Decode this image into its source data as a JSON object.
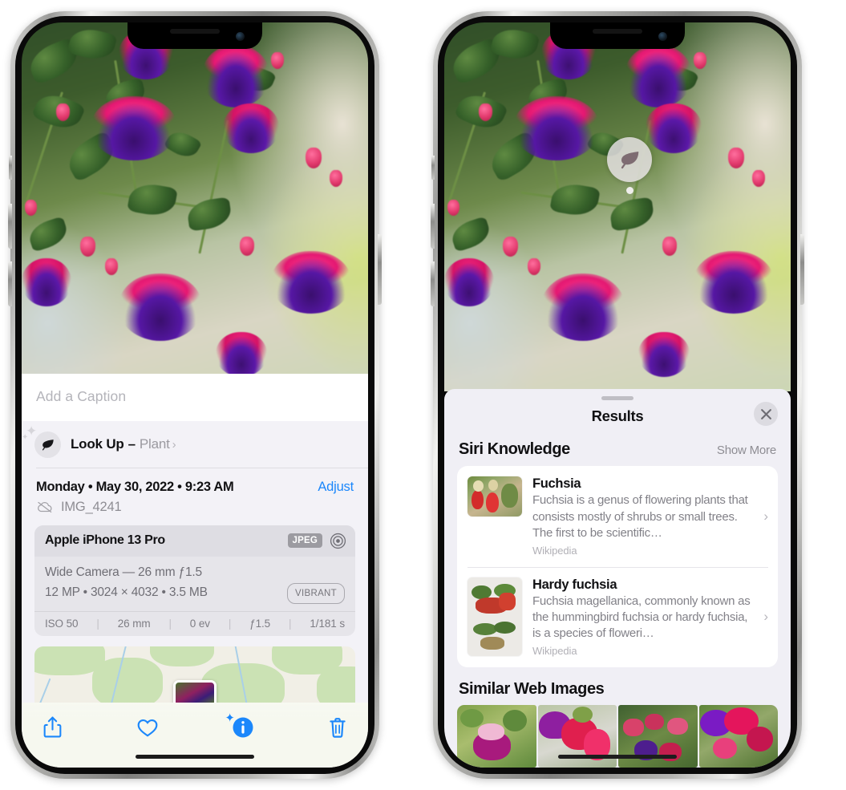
{
  "left_phone": {
    "name": "photos-detail-view",
    "caption_field": {
      "placeholder": "Add a Caption",
      "value": ""
    },
    "look_up": {
      "icon": "leaf-icon",
      "sparkle_icon": "sparkles-icon",
      "label": "Look Up",
      "separator": "–",
      "value": "Plant",
      "chevron": "›"
    },
    "datetime": {
      "text": "Monday • May 30, 2022 • 9:23 AM",
      "adjust_label": "Adjust"
    },
    "filename": {
      "icon": "cloud-slash-icon",
      "text": "IMG_4241"
    },
    "metadata": {
      "device": "Apple iPhone 13 Pro",
      "format_badge": "JPEG",
      "target_icon": "aperture-target-icon",
      "lens_line": "Wide Camera — 26 mm ƒ1.5",
      "specs_line": "12 MP • 3024 × 4032 • 3.5 MB",
      "style_badge": "VIBRANT",
      "exif": [
        {
          "label": "ISO 50"
        },
        {
          "label": "26 mm"
        },
        {
          "label": "0 ev"
        },
        {
          "label": "ƒ1.5"
        },
        {
          "label": "1/181 s"
        }
      ],
      "separator": "|"
    },
    "map": {
      "name": "location-map-strip",
      "pin": "photo-pin"
    },
    "toolbar": [
      {
        "name": "share-button",
        "icon": "share-icon"
      },
      {
        "name": "favorite-button",
        "icon": "heart-icon"
      },
      {
        "name": "info-button",
        "icon": "info-circle-icon"
      },
      {
        "name": "delete-button",
        "icon": "trash-icon"
      }
    ],
    "accent_color": "#1b87fb"
  },
  "right_phone": {
    "name": "visual-lookup-results",
    "photo_badge": {
      "icon": "leaf-icon",
      "name": "visual-lookup-badge"
    },
    "panel": {
      "grabber": "drag-handle",
      "title": "Results",
      "close_icon": "close-icon"
    },
    "siri_knowledge": {
      "title": "Siri Knowledge",
      "show_more": "Show More",
      "items": [
        {
          "title": "Fuchsia",
          "description": "Fuchsia is a genus of flowering plants that consists mostly of shrubs or small trees. The first to be scientific…",
          "source": "Wikipedia",
          "thumb": "fuchsia-red-flowers-thumb",
          "chevron": "›"
        },
        {
          "title": "Hardy fuchsia",
          "description": "Fuchsia magellanica, commonly known as the hummingbird fuchsia or hardy fuchsia, is a species of floweri…",
          "source": "Wikipedia",
          "thumb": "hardy-fuchsia-specimen-thumb",
          "chevron": "›"
        }
      ]
    },
    "similar_web_images": {
      "title": "Similar Web Images",
      "items": [
        {
          "name": "similar-image-1"
        },
        {
          "name": "similar-image-2"
        },
        {
          "name": "similar-image-3"
        },
        {
          "name": "similar-image-4"
        }
      ]
    }
  }
}
